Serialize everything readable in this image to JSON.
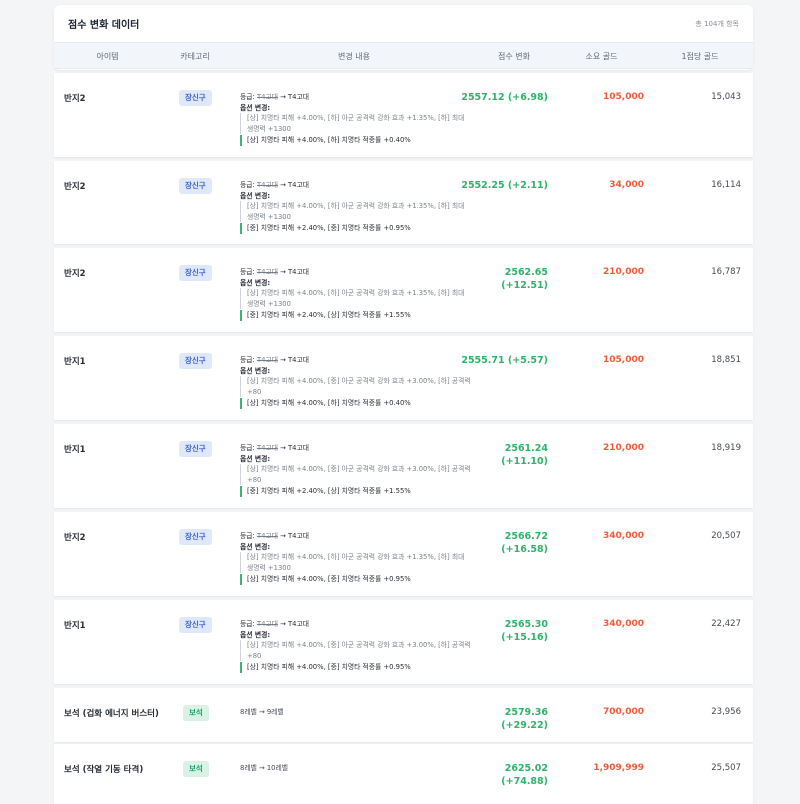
{
  "header": {
    "title": "점수 변화 데이터",
    "count": "총 104개 항목"
  },
  "columns": [
    "아이템",
    "카테고리",
    "변경 내용",
    "점수 변화",
    "소요 골드",
    "1점당 골드"
  ],
  "colors": {
    "score_positive": "#2fb36b",
    "gold": "#f05a3a",
    "badge_equipment_bg": "#dfe9fb",
    "badge_gem_bg": "#d8f3e6"
  },
  "rows": [
    {
      "name": "반지2",
      "category": "장신구",
      "category_type": "equip",
      "grade_label": "등급:",
      "grade_old": "T4고대",
      "grade_arrow": "→",
      "grade_new": "T4고대",
      "option_title": "옵션 변경:",
      "option_old": "[상] 치명타 피해 +4.00%, [하] 아군 공격력 강화 효과 +1.35%, [하] 최대 생명력 +1300",
      "option_new": "[상] 치명타 피해 +4.00%, [하] 치명타 적중률 +0.40%",
      "score": "2557.12 (+6.98)",
      "gold": "105,000",
      "per_point": "15,043"
    },
    {
      "name": "반지2",
      "category": "장신구",
      "category_type": "equip",
      "grade_label": "등급:",
      "grade_old": "T4고대",
      "grade_arrow": "→",
      "grade_new": "T4고대",
      "option_title": "옵션 변경:",
      "option_old": "[상] 치명타 피해 +4.00%, [하] 아군 공격력 강화 효과 +1.35%, [하] 최대 생명력 +1300",
      "option_new": "[중] 치명타 피해 +2.40%, [중] 치명타 적중률 +0.95%",
      "score": "2552.25 (+2.11)",
      "gold": "34,000",
      "per_point": "16,114"
    },
    {
      "name": "반지2",
      "category": "장신구",
      "category_type": "equip",
      "grade_label": "등급:",
      "grade_old": "T4고대",
      "grade_arrow": "→",
      "grade_new": "T4고대",
      "option_title": "옵션 변경:",
      "option_old": "[상] 치명타 피해 +4.00%, [하] 아군 공격력 강화 효과 +1.35%, [하] 최대 생명력 +1300",
      "option_new": "[중] 치명타 피해 +2.40%, [상] 치명타 적중률 +1.55%",
      "score": "2562.65 (+12.51)",
      "gold": "210,000",
      "per_point": "16,787"
    },
    {
      "name": "반지1",
      "category": "장신구",
      "category_type": "equip",
      "grade_label": "등급:",
      "grade_old": "T4고대",
      "grade_arrow": "→",
      "grade_new": "T4고대",
      "option_title": "옵션 변경:",
      "option_old": "[상] 치명타 피해 +4.00%, [중] 아군 공격력 강화 효과 +3.00%, [하] 공격력 +80",
      "option_new": "[상] 치명타 피해 +4.00%, [하] 치명타 적중률 +0.40%",
      "score": "2555.71 (+5.57)",
      "gold": "105,000",
      "per_point": "18,851"
    },
    {
      "name": "반지1",
      "category": "장신구",
      "category_type": "equip",
      "grade_label": "등급:",
      "grade_old": "T4고대",
      "grade_arrow": "→",
      "grade_new": "T4고대",
      "option_title": "옵션 변경:",
      "option_old": "[상] 치명타 피해 +4.00%, [중] 아군 공격력 강화 효과 +3.00%, [하] 공격력 +80",
      "option_new": "[중] 치명타 피해 +2.40%, [상] 치명타 적중률 +1.55%",
      "score": "2561.24 (+11.10)",
      "gold": "210,000",
      "per_point": "18,919"
    },
    {
      "name": "반지2",
      "category": "장신구",
      "category_type": "equip",
      "grade_label": "등급:",
      "grade_old": "T4고대",
      "grade_arrow": "→",
      "grade_new": "T4고대",
      "option_title": "옵션 변경:",
      "option_old": "[상] 치명타 피해 +4.00%, [하] 아군 공격력 강화 효과 +1.35%, [하] 최대 생명력 +1300",
      "option_new": "[상] 치명타 피해 +4.00%, [중] 치명타 적중률 +0.95%",
      "score": "2566.72 (+16.58)",
      "gold": "340,000",
      "per_point": "20,507"
    },
    {
      "name": "반지1",
      "category": "장신구",
      "category_type": "equip",
      "grade_label": "등급:",
      "grade_old": "T4고대",
      "grade_arrow": "→",
      "grade_new": "T4고대",
      "option_title": "옵션 변경:",
      "option_old": "[상] 치명타 피해 +4.00%, [중] 아군 공격력 강화 효과 +3.00%, [하] 공격력 +80",
      "option_new": "[상] 치명타 피해 +4.00%, [중] 치명타 적중률 +0.95%",
      "score": "2565.30 (+15.16)",
      "gold": "340,000",
      "per_point": "22,427"
    },
    {
      "name": "보석 (겁화 에너지 버스터)",
      "category": "보석",
      "category_type": "gem",
      "gem_change": "8레벨 → 9레벨",
      "score": "2579.36 (+29.22)",
      "gold": "700,000",
      "per_point": "23,956"
    },
    {
      "name": "보석 (작열 기동 타격)",
      "category": "보석",
      "category_type": "gem",
      "gem_change": "8레벨 → 10레벨",
      "score": "2625.02 (+74.88)",
      "gold": "1,909,999",
      "per_point": "25,507"
    }
  ]
}
